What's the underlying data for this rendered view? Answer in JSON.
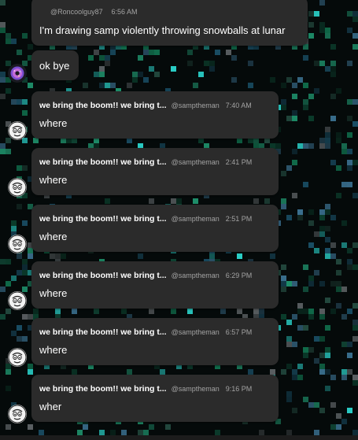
{
  "first_message": {
    "handle": "@Roncoolguy87",
    "time": "6:56 AM",
    "text": "I'm drawing samp violently throwing snowballs at lunar"
  },
  "second_message": {
    "text": "ok bye",
    "avatar_icon": "purple-donut-avatar-icon"
  },
  "messages": [
    {
      "name": "we bring the boom!! we bring t...",
      "handle": "@samptheman",
      "time": "7:40 AM",
      "text": "where"
    },
    {
      "name": "we bring the boom!! we bring t...",
      "handle": "@samptheman",
      "time": "2:41 PM",
      "text": "where"
    },
    {
      "name": "we bring the boom!! we bring t...",
      "handle": "@samptheman",
      "time": "2:51 PM",
      "text": "where"
    },
    {
      "name": "we bring the boom!! we bring t...",
      "handle": "@samptheman",
      "time": "6:29 PM",
      "text": "where"
    },
    {
      "name": "we bring the boom!! we bring t...",
      "handle": "@samptheman",
      "time": "6:57 PM",
      "text": "where"
    },
    {
      "name": "we bring the boom!! we bring t...",
      "handle": "@samptheman",
      "time": "9:16 PM",
      "text": "wher"
    }
  ],
  "theme": {
    "bubble": "#2b2b2b",
    "background": "#050a0a",
    "pixel_colors": [
      "#0b3a2a",
      "#106b4a",
      "#1e8f6a",
      "#2ad0c8",
      "#1a4f66",
      "#234a3f",
      "#5a5f62",
      "#3a6f8e"
    ]
  }
}
